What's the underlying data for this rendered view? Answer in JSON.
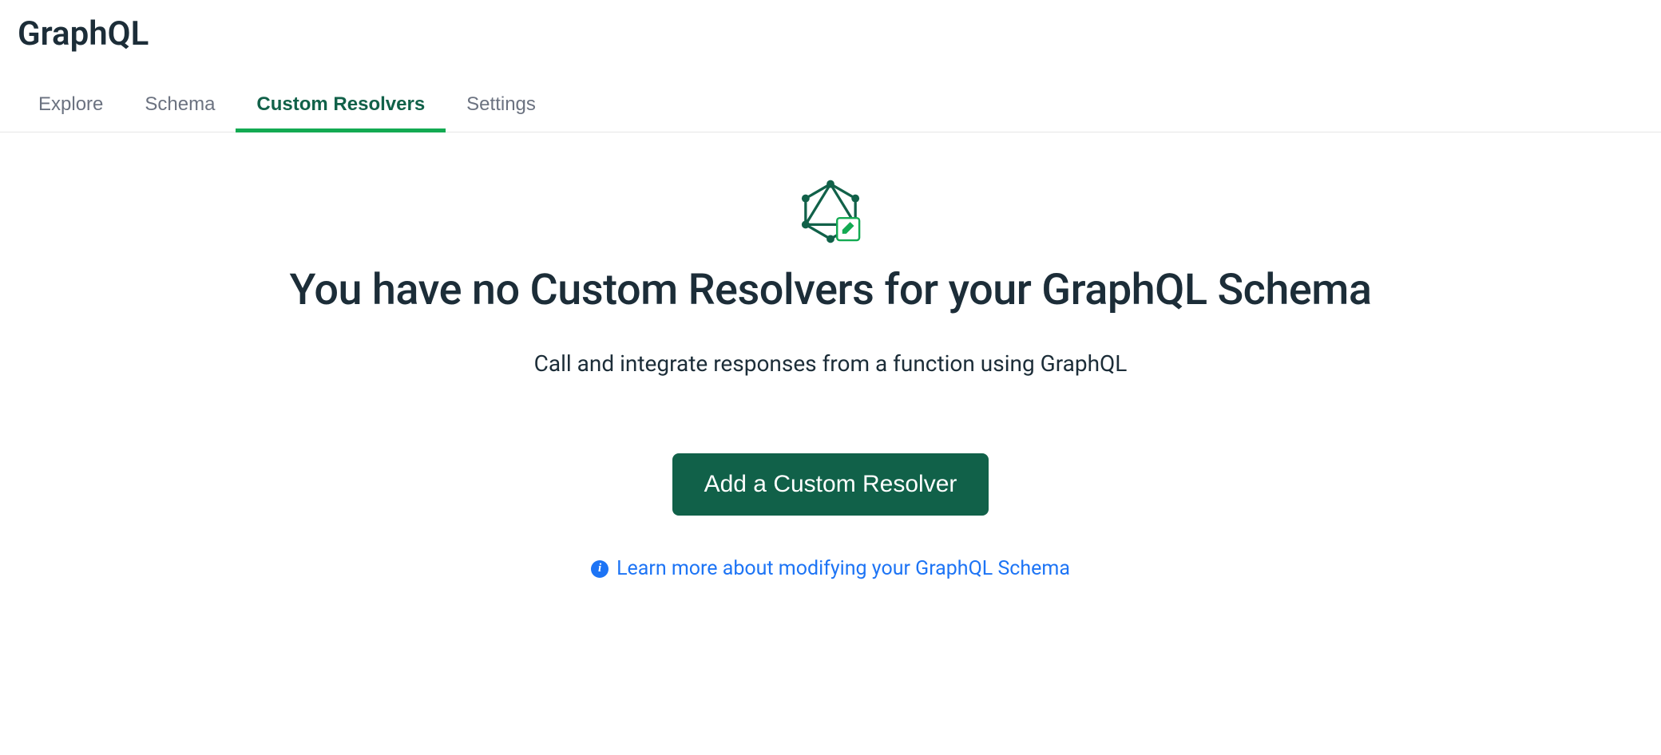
{
  "header": {
    "title": "GraphQL"
  },
  "tabs": [
    {
      "label": "Explore",
      "active": false
    },
    {
      "label": "Schema",
      "active": false
    },
    {
      "label": "Custom Resolvers",
      "active": true
    },
    {
      "label": "Settings",
      "active": false
    }
  ],
  "emptyState": {
    "headline": "You have no Custom Resolvers for your GraphQL Schema",
    "subtext": "Call and integrate responses from a function using GraphQL",
    "ctaLabel": "Add a Custom Resolver",
    "learnMore": "Learn more about modifying your GraphQL Schema"
  }
}
